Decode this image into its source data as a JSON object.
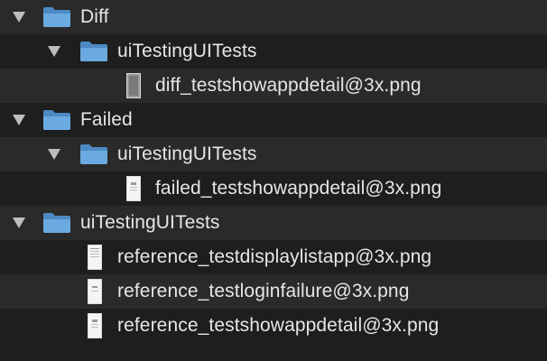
{
  "colors": {
    "background": "#1e1e1e",
    "row_alt": "#2a2a2a",
    "text": "#e6e6e6",
    "folder": "#5b9bd5",
    "disclosure": "#bdbdbd"
  },
  "tree": {
    "items": [
      {
        "label": "Diff",
        "kind": "folder",
        "depth": 0,
        "expanded": true,
        "icon": "folder-icon"
      },
      {
        "label": "uiTestingUITests",
        "kind": "folder",
        "depth": 1,
        "expanded": true,
        "icon": "folder-icon"
      },
      {
        "label": "diff_testshowappdetail@3x.png",
        "kind": "file",
        "depth": 2,
        "icon": "image-file-icon"
      },
      {
        "label": "Failed",
        "kind": "folder",
        "depth": 0,
        "expanded": true,
        "icon": "folder-icon"
      },
      {
        "label": "uiTestingUITests",
        "kind": "folder",
        "depth": 1,
        "expanded": true,
        "icon": "folder-icon"
      },
      {
        "label": "failed_testshowappdetail@3x.png",
        "kind": "file",
        "depth": 2,
        "icon": "image-file-icon"
      },
      {
        "label": "uiTestingUITests",
        "kind": "folder",
        "depth": 0,
        "expanded": true,
        "icon": "folder-icon"
      },
      {
        "label": "reference_testdisplaylistapp@3x.png",
        "kind": "file",
        "depth": 1,
        "icon": "image-file-icon"
      },
      {
        "label": "reference_testloginfailure@3x.png",
        "kind": "file",
        "depth": 1,
        "icon": "image-file-icon"
      },
      {
        "label": "reference_testshowappdetail@3x.png",
        "kind": "file",
        "depth": 1,
        "icon": "image-file-icon"
      }
    ]
  }
}
